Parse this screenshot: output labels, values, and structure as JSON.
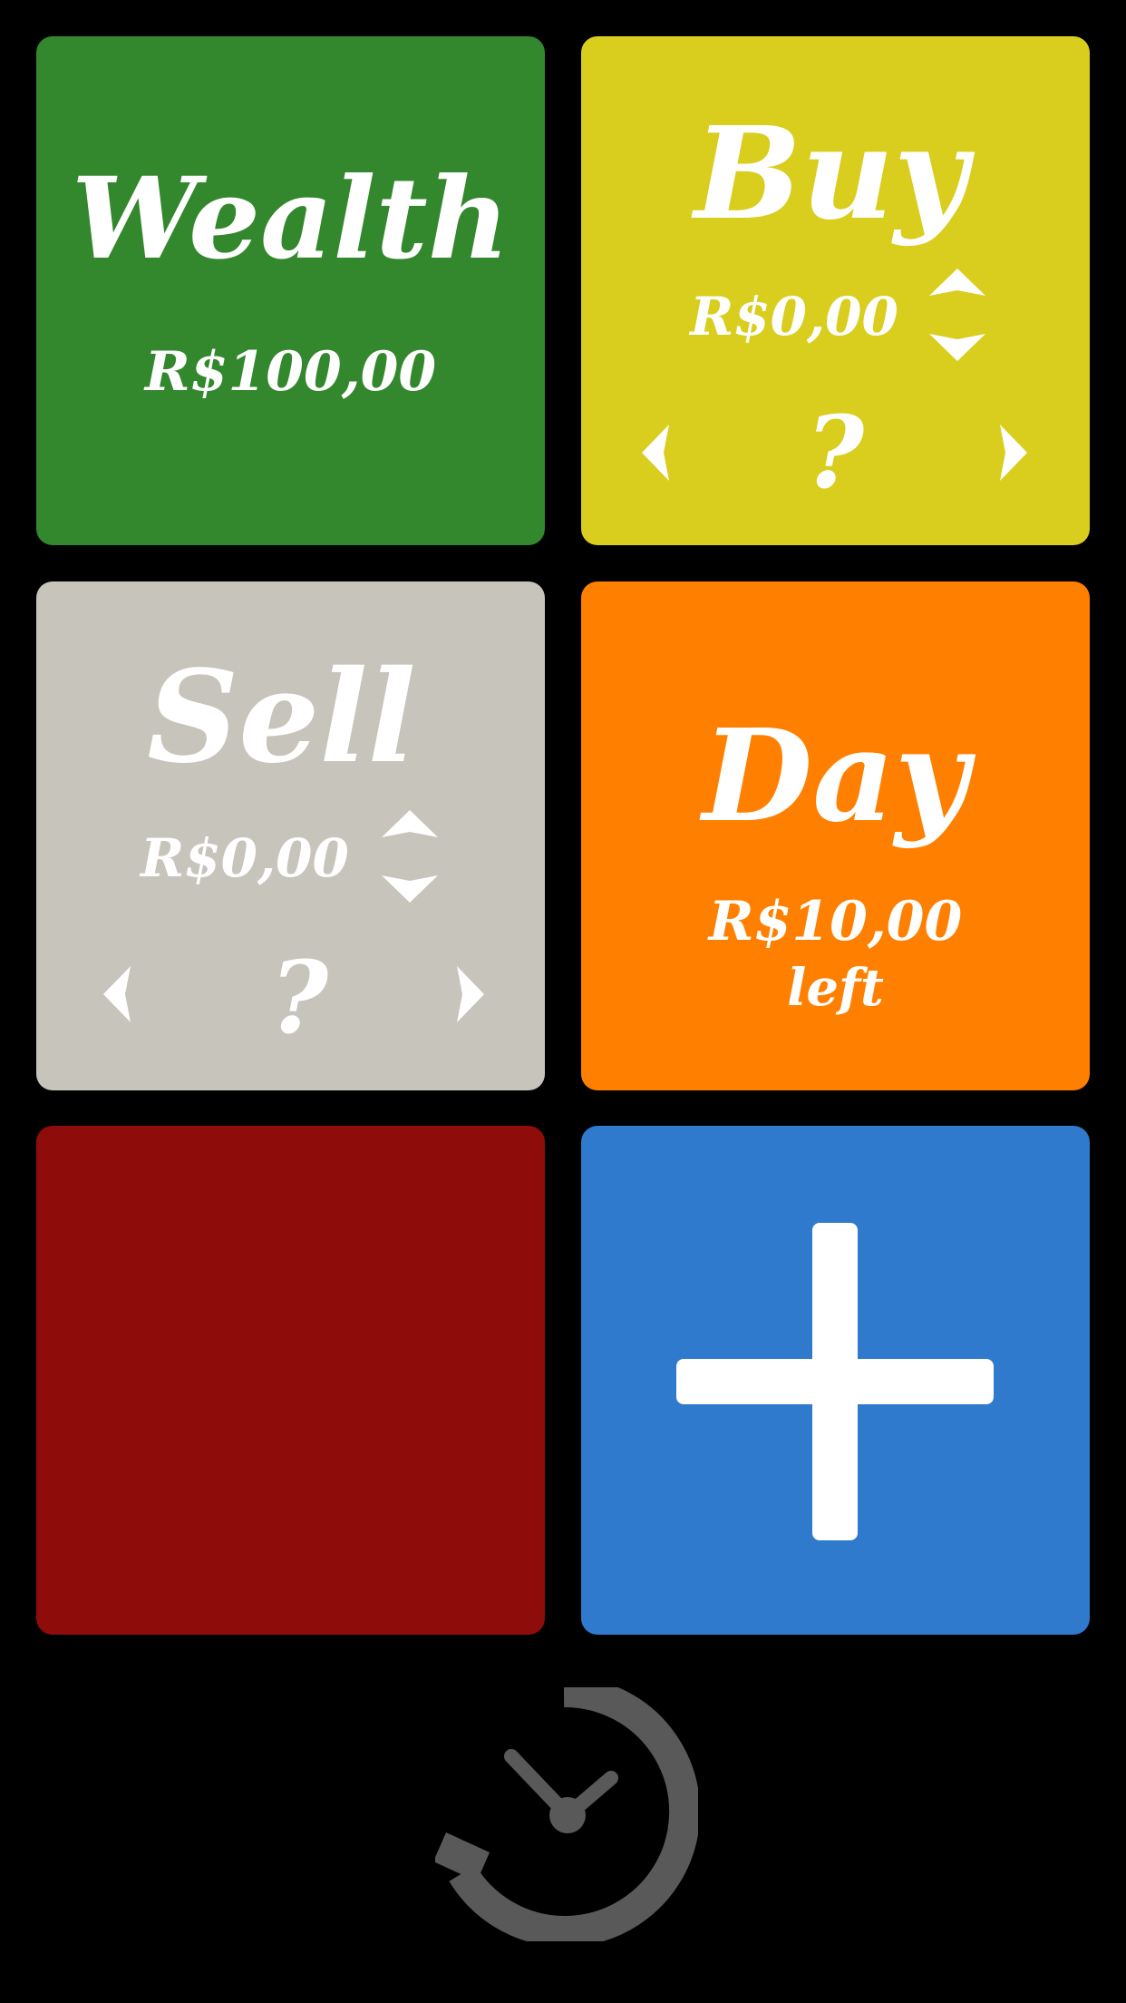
{
  "tiles": {
    "wealth": {
      "title": "Wealth",
      "amount": "R$100,00",
      "color": "#33872c"
    },
    "buy": {
      "title": "Buy",
      "amount": "R$0,00",
      "help": "?",
      "color": "#d9cd1e"
    },
    "sell": {
      "title": "Sell",
      "amount": "R$0,00",
      "help": "?",
      "color": "#c7c4bc"
    },
    "day": {
      "title": "Day",
      "amount": "R$10,00",
      "suffix": "left",
      "color": "#ff8000"
    },
    "red_tile": {
      "color": "#8e0c0a"
    },
    "add": {
      "icon": "plus-icon",
      "color": "#2f7acd"
    }
  },
  "reset": {
    "icon": "stopwatch-reset-icon",
    "color": "#595959"
  }
}
